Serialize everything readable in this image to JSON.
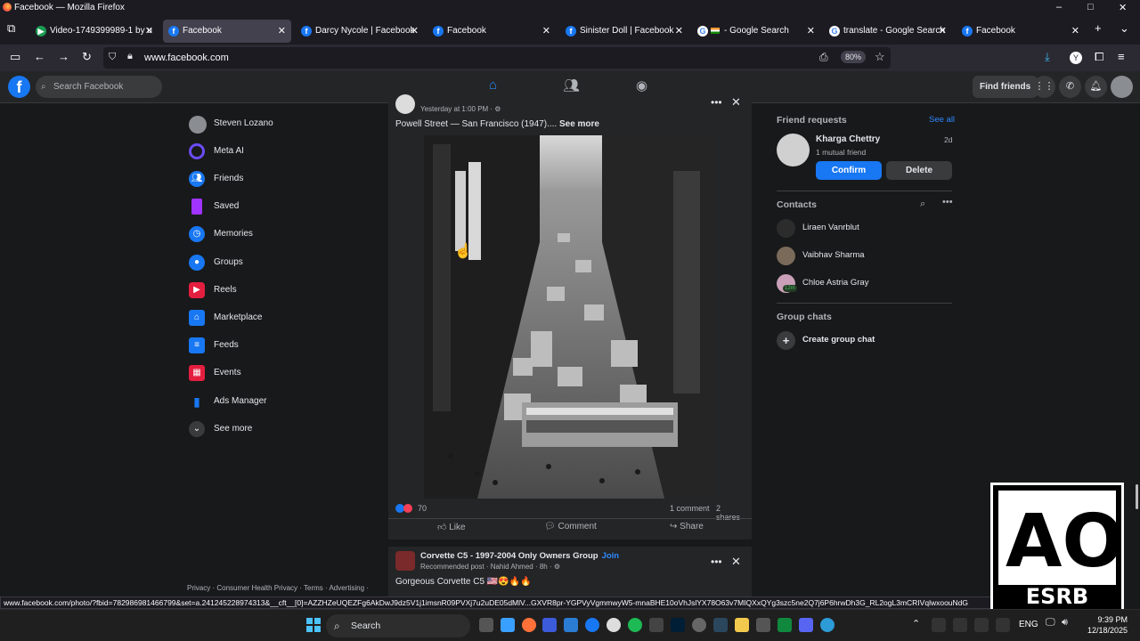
{
  "window": {
    "title": "Facebook — Mozilla Firefox",
    "controls": [
      "–",
      "□",
      "✕"
    ]
  },
  "tabs": [
    {
      "label": "Video-1749399989-1 by u",
      "active": false
    },
    {
      "label": "Facebook",
      "active": true
    },
    {
      "label": "Darcy Nycole | Facebook",
      "active": false
    },
    {
      "label": "Facebook",
      "active": false
    },
    {
      "label": "Sinister Doll | Facebook",
      "active": false
    },
    {
      "label": "- Google Search",
      "active": false
    },
    {
      "label": "translate - Google Search",
      "active": false
    },
    {
      "label": "Facebook",
      "active": false
    }
  ],
  "navbar": {
    "url": "www.facebook.com",
    "zoom": "80%"
  },
  "fb_header": {
    "search_placeholder": "Search Facebook",
    "find_friends": "Find friends"
  },
  "left_sidebar": {
    "items": [
      {
        "label": "Steven Lozano",
        "icon": "profile-avatar"
      },
      {
        "label": "Meta AI",
        "icon": "meta-ai-icon",
        "color": "#6b4cf6"
      },
      {
        "label": "Friends",
        "icon": "friends-icon",
        "color": "#1877f2"
      },
      {
        "label": "Saved",
        "icon": "saved-icon",
        "color": "#a033ff"
      },
      {
        "label": "Memories",
        "icon": "memories-icon",
        "color": "#1877f2"
      },
      {
        "label": "Groups",
        "icon": "groups-icon",
        "color": "#1877f2"
      },
      {
        "label": "Reels",
        "icon": "reels-icon",
        "color": "#e41e3f"
      },
      {
        "label": "Marketplace",
        "icon": "marketplace-icon",
        "color": "#1877f2"
      },
      {
        "label": "Feeds",
        "icon": "feeds-icon",
        "color": "#1877f2"
      },
      {
        "label": "Events",
        "icon": "events-icon",
        "color": "#e41e3f"
      },
      {
        "label": "Ads Manager",
        "icon": "ads-manager-icon",
        "color": "#1877f2"
      },
      {
        "label": "See more",
        "icon": "chevron-down-icon",
        "color": "#3a3b3c"
      }
    ],
    "footer": "Privacy · Consumer Health Privacy · Terms · Advertising ·"
  },
  "post1": {
    "timestamp": "Yesterday at 1:00 PM · ⚙",
    "caption": "Powell Street — San Francisco (1947)....",
    "see_more": "See more",
    "reactions_count": "70",
    "comments": "1 comment",
    "shares": "2 shares",
    "like": "Like",
    "comment": "Comment",
    "share": "Share"
  },
  "post2": {
    "group": "Corvette C5 - 1997-2004 Only Owners Group",
    "join": "Join",
    "sub": "Recommended post · Nahid Ahmed · 8h · ⚙",
    "body": "Gorgeous Corvette C5 🇺🇸😍🔥🔥"
  },
  "right_sidebar": {
    "friend_requests": "Friend requests",
    "see_all": "See all",
    "requester_name": "Kharga Chettry",
    "request_age": "2d",
    "mutual": "1 mutual friend",
    "confirm": "Confirm",
    "delete": "Delete",
    "contacts_title": "Contacts",
    "contacts": [
      {
        "name": "Liraen Vanrblut"
      },
      {
        "name": "Vaibhav Sharma"
      },
      {
        "name": "Chloe Astria Gray",
        "badge": "12m"
      }
    ],
    "group_chats": "Group chats",
    "create_group": "Create group chat"
  },
  "status_url": "www.facebook.com/photo/?fbid=782986981466799&set=a.241245228974313&__cft__[0]=AZZHZeUQEZFg6AkDwJ9dz5V1j1imsnR09PVXj7u2uDE05dMlV...GXVR8pr-YGPVyVgmmwyW5-mnaBHE10oVhJslYX78O63v7MIQXxQYg3szc5ne2Q7j6P6hrwDh3G_RL2ogL3mCRIVqlwxoouNdG",
  "taskbar": {
    "search": "Search",
    "lang": "ENG",
    "time": "9:39 PM",
    "date": "12/18/2025"
  },
  "esrb": {
    "rating": "AO",
    "label": "ESRB"
  }
}
